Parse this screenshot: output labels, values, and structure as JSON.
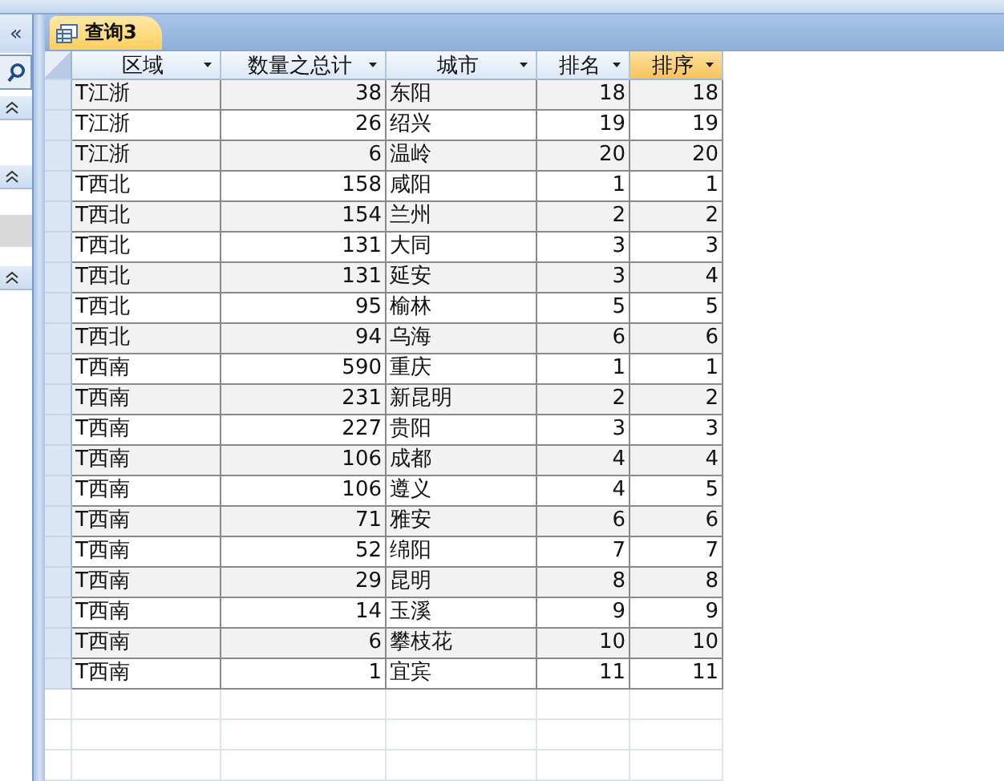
{
  "nav_pane": {
    "collapse_button": "«"
  },
  "document_tab": {
    "title": "查询3",
    "selected": true
  },
  "table": {
    "columns": [
      {
        "label": "区域",
        "selected": false
      },
      {
        "label": "数量之总计",
        "selected": false
      },
      {
        "label": "城市",
        "selected": false
      },
      {
        "label": "排名",
        "selected": false
      },
      {
        "label": "排序",
        "selected": true
      }
    ],
    "rows": [
      [
        "T江浙",
        "38",
        "东阳",
        "18",
        "18"
      ],
      [
        "T江浙",
        "26",
        "绍兴",
        "19",
        "19"
      ],
      [
        "T江浙",
        "6",
        "温岭",
        "20",
        "20"
      ],
      [
        "T西北",
        "158",
        "咸阳",
        "1",
        "1"
      ],
      [
        "T西北",
        "154",
        "兰州",
        "2",
        "2"
      ],
      [
        "T西北",
        "131",
        "大同",
        "3",
        "3"
      ],
      [
        "T西北",
        "131",
        "延安",
        "3",
        "4"
      ],
      [
        "T西北",
        "95",
        "榆林",
        "5",
        "5"
      ],
      [
        "T西北",
        "94",
        "乌海",
        "6",
        "6"
      ],
      [
        "T西南",
        "590",
        "重庆",
        "1",
        "1"
      ],
      [
        "T西南",
        "231",
        "新昆明",
        "2",
        "2"
      ],
      [
        "T西南",
        "227",
        "贵阳",
        "3",
        "3"
      ],
      [
        "T西南",
        "106",
        "成都",
        "4",
        "4"
      ],
      [
        "T西南",
        "106",
        "遵义",
        "4",
        "5"
      ],
      [
        "T西南",
        "71",
        "雅安",
        "6",
        "6"
      ],
      [
        "T西南",
        "52",
        "绵阳",
        "7",
        "7"
      ],
      [
        "T西南",
        "29",
        "昆明",
        "8",
        "8"
      ],
      [
        "T西南",
        "14",
        "玉溪",
        "9",
        "9"
      ],
      [
        "T西南",
        "6",
        "攀枝花",
        "10",
        "10"
      ],
      [
        "T西南",
        "1",
        "宜宾",
        "11",
        "11"
      ]
    ]
  }
}
